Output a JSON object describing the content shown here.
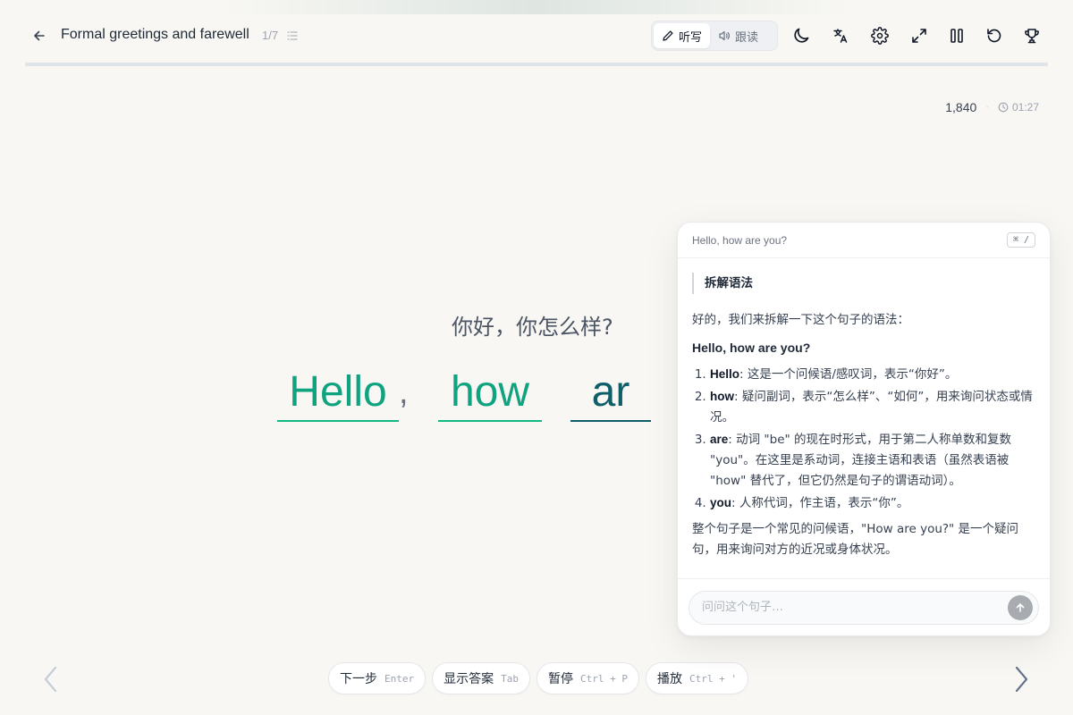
{
  "header": {
    "lesson_title": "Formal greetings and farewell",
    "lesson_progress": "1/7",
    "modes": [
      {
        "label": "听写",
        "icon": "pencil-icon",
        "active": true
      },
      {
        "label": "跟读",
        "icon": "speaker-icon",
        "active": false
      }
    ],
    "tools": [
      "moon-icon",
      "translate-icon",
      "gear-icon",
      "expand-icon",
      "pause-icon",
      "restart-icon",
      "trophy-icon"
    ]
  },
  "stats": {
    "score": "1,840",
    "separator": "·",
    "timer": "01:27"
  },
  "exercise": {
    "translation": "你好，你怎么样?",
    "words": [
      "Hello",
      "how",
      "ar"
    ],
    "comma": ","
  },
  "actions": [
    {
      "label": "下一步",
      "shortcut": "Enter"
    },
    {
      "label": "显示答案",
      "shortcut": "Tab"
    },
    {
      "label": "暂停",
      "shortcut": "Ctrl + P"
    },
    {
      "label": "播放",
      "shortcut": "Ctrl + '"
    }
  ],
  "panel": {
    "sentence": "Hello, how are you?",
    "shortcut": "⌘ /",
    "quote": "拆解语法",
    "intro": "好的，我们来拆解一下这个句子的语法：",
    "bold_sentence": "Hello, how are you?",
    "items": [
      {
        "term": "Hello",
        "text": ": 这是一个问候语/感叹词，表示“你好”。"
      },
      {
        "term": "how",
        "text": ": 疑问副词，表示“怎么样”、“如何”，用来询问状态或情况。"
      },
      {
        "term": "are",
        "text": ": 动词 \"be\" 的现在时形式，用于第二人称单数和复数 \"you\"。在这里是系动词，连接主语和表语（虽然表语被 \"how\" 替代了，但它仍然是句子的谓语动词）。"
      },
      {
        "term": "you",
        "text": ": 人称代词，作主语，表示“你”。"
      }
    ],
    "summary": "整个句子是一个常见的问候语，\"How are you?\" 是一个疑问句，用来询问对方的近况或身体状况。",
    "input_placeholder": "问问这个句子…"
  },
  "colors": {
    "correct": "#10a37f",
    "current": "#0f5f6a",
    "background": "#f8f7f3"
  }
}
